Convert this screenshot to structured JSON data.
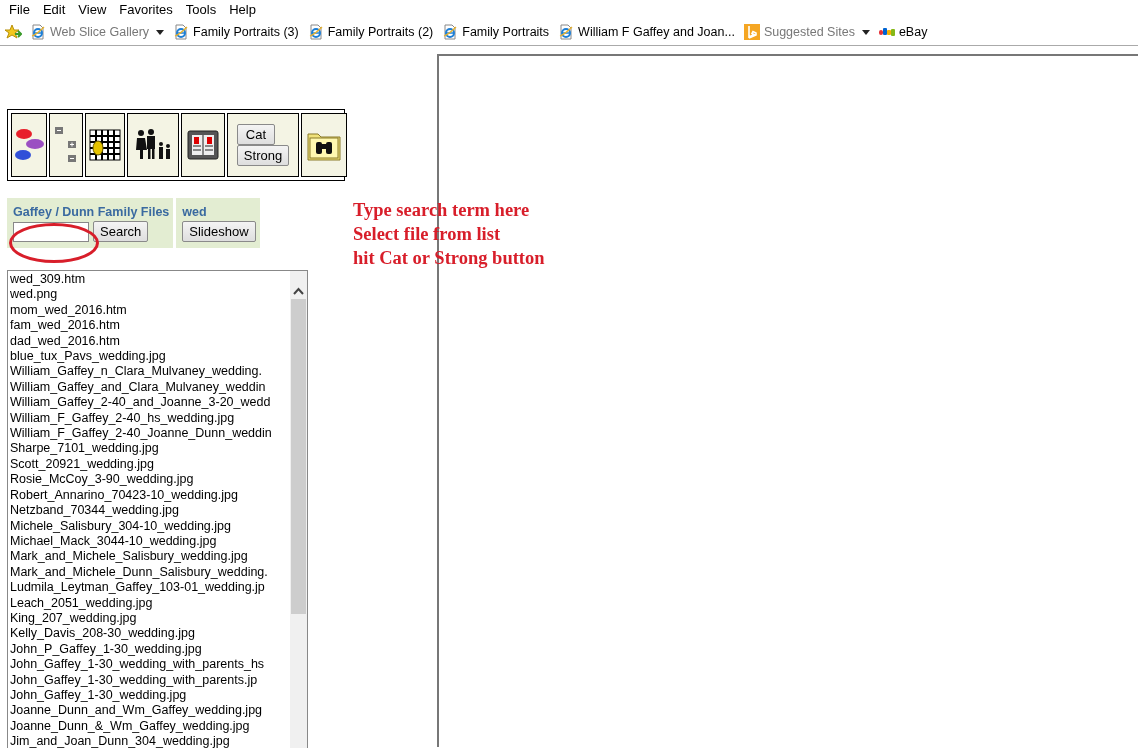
{
  "menu": [
    "File",
    "Edit",
    "View",
    "Favorites",
    "Tools",
    "Help"
  ],
  "favorites": [
    {
      "label": "Web Slice Gallery",
      "kind": "dropdown"
    },
    {
      "label": "Family Portraits (3)",
      "kind": "link"
    },
    {
      "label": "Family Portraits (2)",
      "kind": "link"
    },
    {
      "label": "Family Portraits",
      "kind": "link"
    },
    {
      "label": "William F Gaffey and Joan...",
      "kind": "link"
    },
    {
      "label": "Suggested Sites",
      "kind": "dropdown"
    },
    {
      "label": "eBay",
      "kind": "link"
    }
  ],
  "toolbar": {
    "buttons": [
      "Cat",
      "Strong"
    ]
  },
  "search_panel": {
    "title": "Gaffey / Dunn Family Files",
    "search_button": "Search",
    "folder": "wed",
    "slideshow_button": "Slideshow"
  },
  "file_list": [
    "wed_309.htm",
    "wed.png",
    "mom_wed_2016.htm",
    "fam_wed_2016.htm",
    "dad_wed_2016.htm",
    "blue_tux_Pavs_wedding.jpg",
    "William_Gaffey_n_Clara_Mulvaney_wedding.",
    "William_Gaffey_and_Clara_Mulvaney_weddin",
    "William_Gaffey_2-40_and_Joanne_3-20_wedd",
    "William_F_Gaffey_2-40_hs_wedding.jpg",
    "William_F_Gaffey_2-40_Joanne_Dunn_weddin",
    "Sharpe_7101_wedding.jpg",
    "Scott_20921_wedding.jpg",
    "Rosie_McCoy_3-90_wedding.jpg",
    "Robert_Annarino_70423-10_wedding.jpg",
    "Netzband_70344_wedding.jpg",
    "Michele_Salisbury_304-10_wedding.jpg",
    "Michael_Mack_3044-10_wedding.jpg",
    "Mark_and_Michele_Salisbury_wedding.jpg",
    "Mark_and_Michele_Dunn_Salisbury_wedding.",
    "Ludmila_Leytman_Gaffey_103-01_wedding.jp",
    "Leach_2051_wedding.jpg",
    "King_207_wedding.jpg",
    "Kelly_Davis_208-30_wedding.jpg",
    "John_P_Gaffey_1-30_wedding.jpg",
    "John_Gaffey_1-30_wedding_with_parents_hs",
    "John_Gaffey_1-30_wedding_with_parents.jp",
    "John_Gaffey_1-30_wedding.jpg",
    "Joanne_Dunn_and_Wm_Gaffey_wedding.jpg",
    "Joanne_Dunn_&_Wm_Gaffey_wedding.jpg",
    "Jim_and_Joan_Dunn_304_wedding.jpg"
  ],
  "instructions": [
    "Type search term here",
    "Select file from list",
    "hit Cat or Strong button"
  ]
}
